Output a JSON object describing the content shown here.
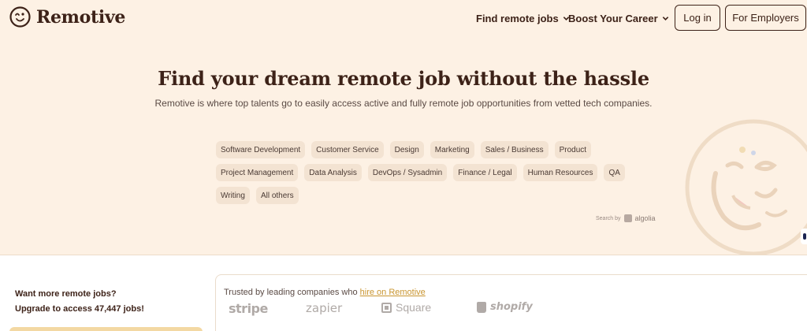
{
  "brand": {
    "name": "Remotive"
  },
  "nav": {
    "links": [
      {
        "label": "Find remote jobs"
      },
      {
        "label": "Boost Your Career"
      }
    ],
    "login_label": "Log in",
    "employers_label": "For Employers"
  },
  "hero": {
    "title": "Find your dream remote job without the hassle",
    "subtitle": "Remotive is where top talents go to easily access active and fully remote job opportunities from vetted tech companies."
  },
  "categories": [
    "Software Development",
    "Customer Service",
    "Design",
    "Marketing",
    "Sales / Business",
    "Product",
    "Project Management",
    "Data Analysis",
    "DevOps / Sysadmin",
    "Finance / Legal",
    "Human Resources",
    "QA",
    "Writing",
    "All others"
  ],
  "search_credit": {
    "prefix": "Search by",
    "brand": "algolia"
  },
  "upgrade": {
    "line1": "Want more remote jobs?",
    "line2": "Upgrade to access 47,447 jobs!"
  },
  "trusted": {
    "prefix": "Trusted by leading companies who ",
    "link": "hire on Remotive",
    "companies": [
      "stripe",
      "zapier",
      "Square",
      "shopify"
    ]
  },
  "colors": {
    "background": "#fdf1e4",
    "brand_dark": "#3d2218",
    "tag_bg": "#f3e3d2",
    "link_gold": "#c99530",
    "upgrade_accent": "#f3d8a3"
  },
  "icons": [
    "remotive-logo-icon",
    "chevron-down-icon",
    "algolia-icon",
    "mascot-face-illustration",
    "square-icon",
    "shopify-bag-icon"
  ]
}
